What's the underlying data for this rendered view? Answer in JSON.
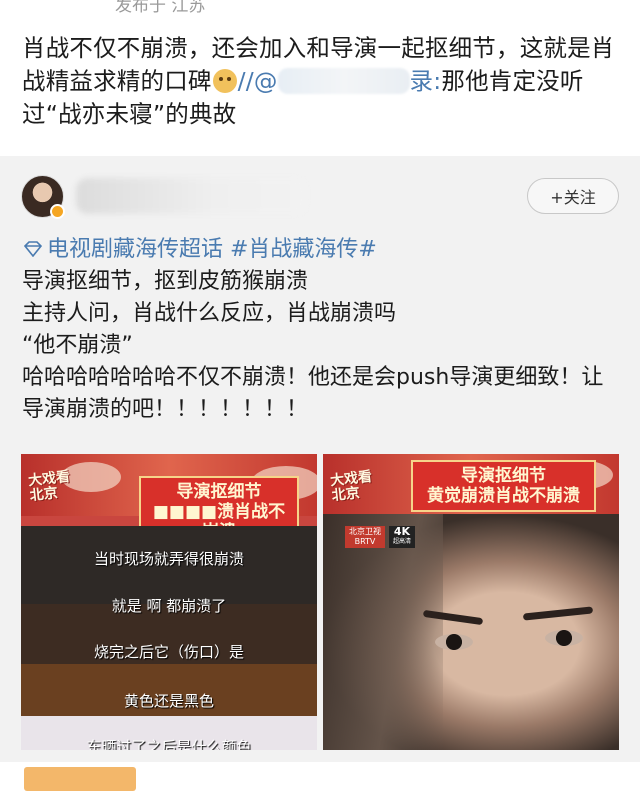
{
  "repost": {
    "location_line": "发布于 江苏",
    "text_part1": "肖战不仅不崩溃，还会加入和导演一起抠细节，这就是肖战精益求精的口碑",
    "mention_prefix": "//@",
    "mention_suffix": "录:",
    "text_part2": "那他肯定没听过“战亦未寝”的典故",
    "emoji_icon": "doge-emoji-icon"
  },
  "original": {
    "follow_label": "+关注",
    "topic_line": "电视剧藏海传超话 #肖战藏海传#",
    "lines": [
      "导演抠细节，抠到皮筋猴崩溃",
      "主持人问，肖战什么反应，肖战崩溃吗",
      "“他不崩溃”",
      "哈哈哈哈哈哈哈不仅不崩溃！他还是会push导演更细致！让导演崩溃的吧！！！！！！！"
    ],
    "media": [
      {
        "show_logo": "大戏看北京",
        "title_line1": "导演抠细节",
        "title_line2": "■■■■溃肖战不崩溃",
        "subtitles": [
          "当时现场就弄得很崩溃",
          "就是 啊 都崩溃了",
          "烧完之后它（伤口）是",
          "黄色还是黑色",
          "东晒过了之后是什么颜色"
        ]
      },
      {
        "show_logo": "大戏看北京",
        "title_line1": "导演抠细节",
        "title_line2": "黄觉崩溃肖战不崩溃",
        "channel_badge": "北京卫视 BRTV",
        "quality_badge": "4K",
        "quality_sub": "超高清"
      }
    ]
  },
  "colors": {
    "link": "#4a7bb0",
    "banner_red": "#d8302a",
    "card_bg": "#f2f2f2"
  }
}
